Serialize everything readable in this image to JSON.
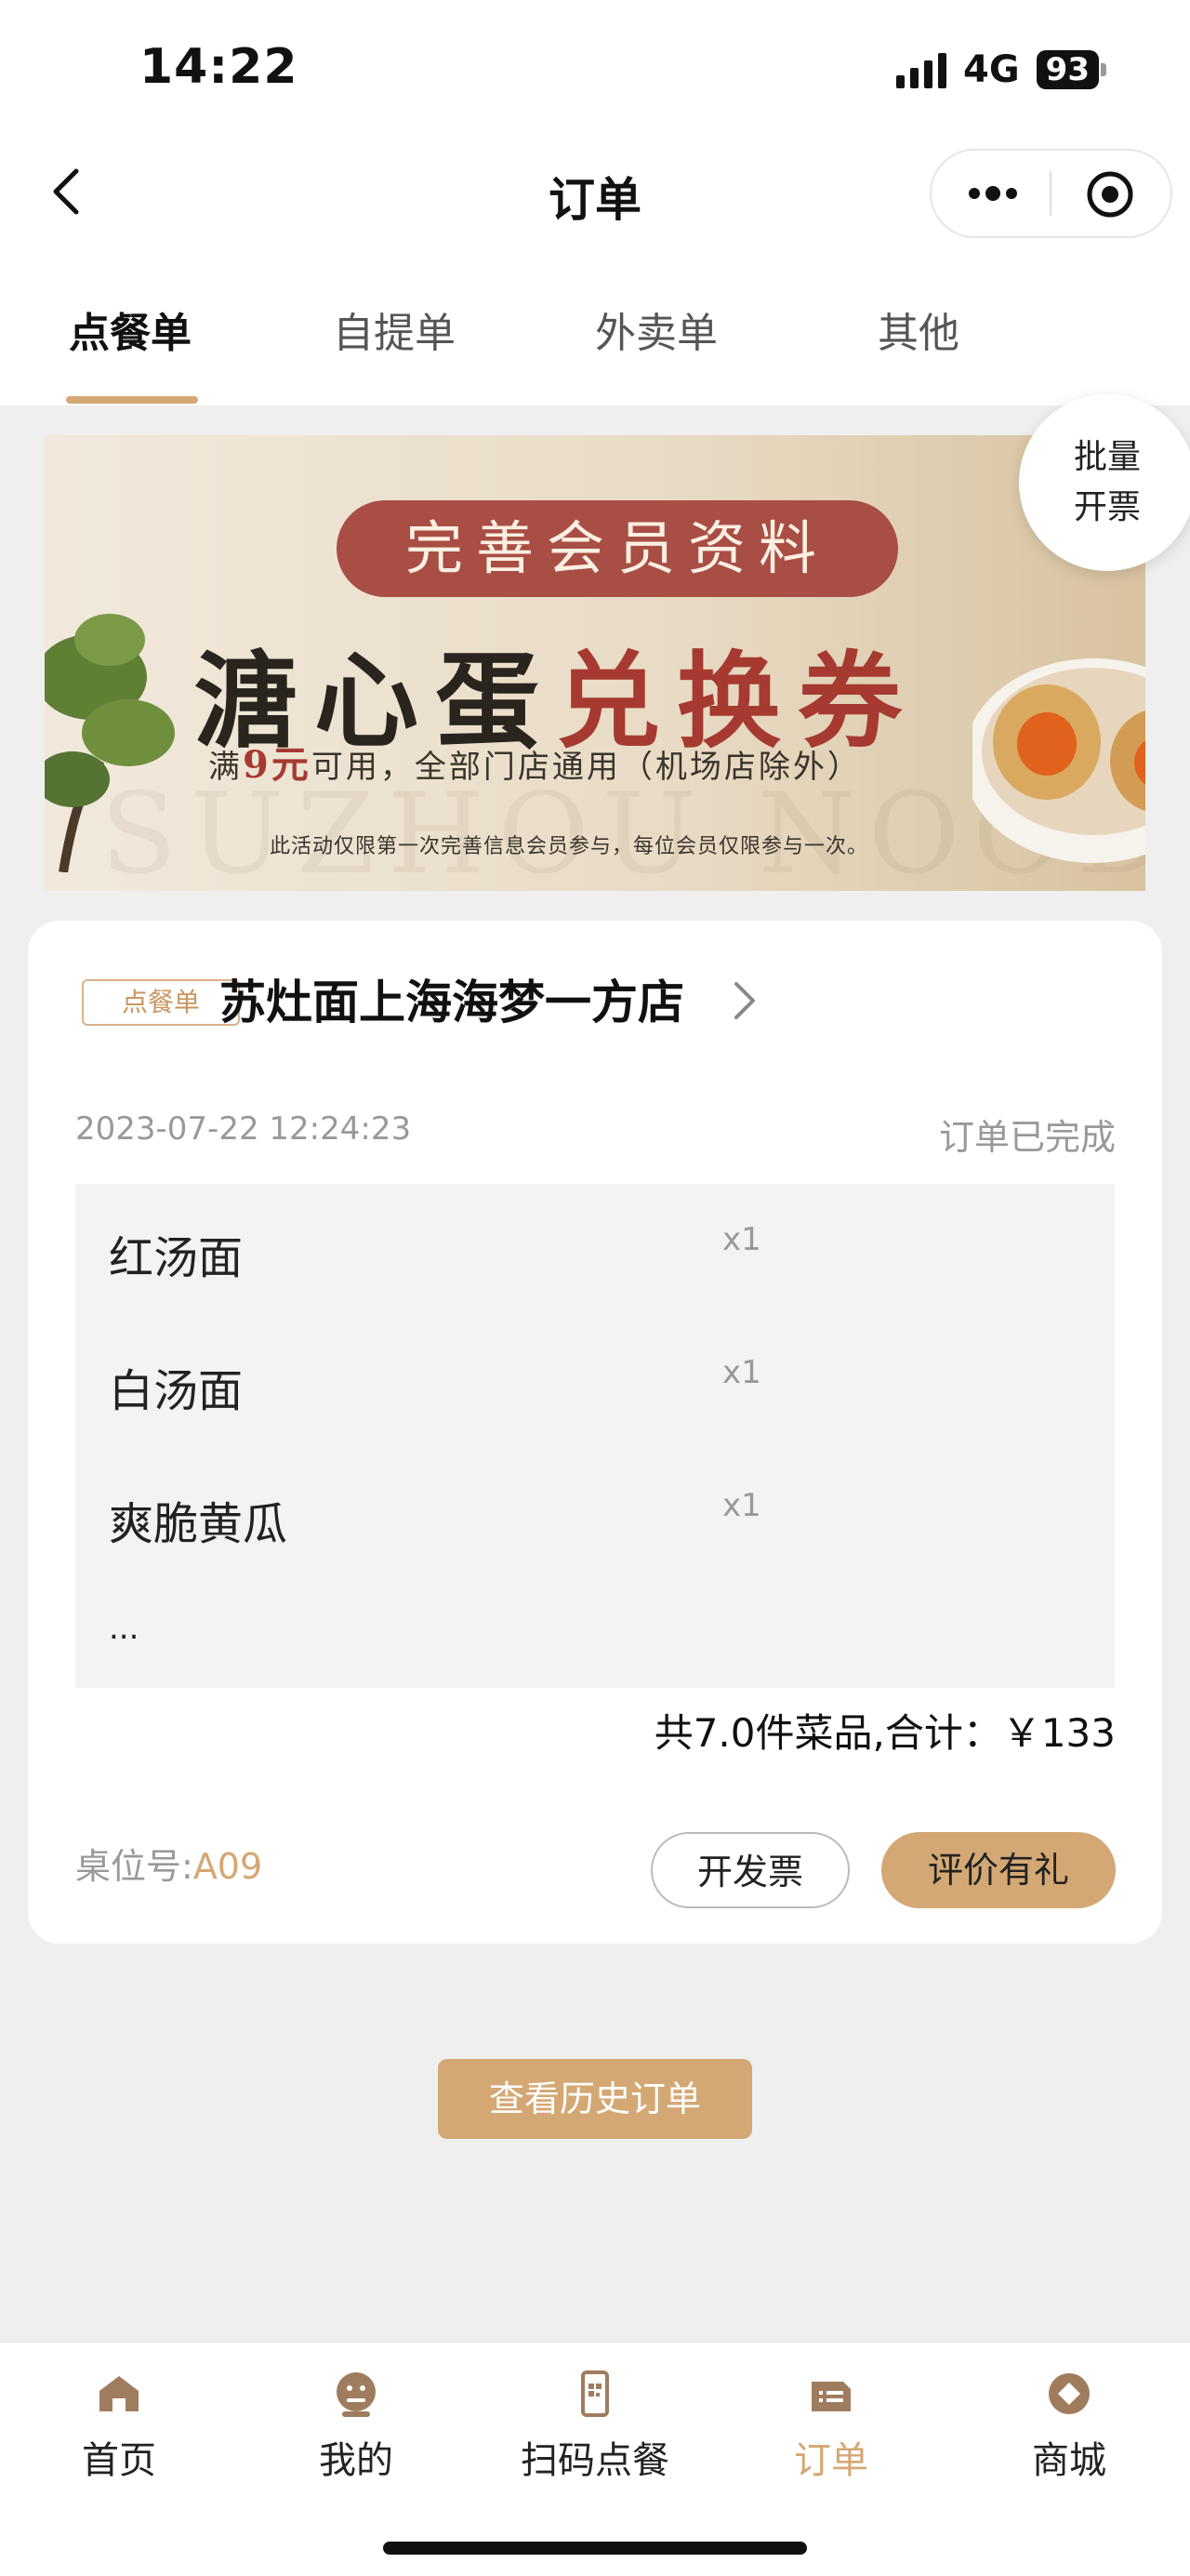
{
  "status_bar": {
    "time": "14:22",
    "network": "4G",
    "battery": "93"
  },
  "nav": {
    "title": "订单"
  },
  "tabs": [
    {
      "label": "点餐单",
      "active": true
    },
    {
      "label": "自提单",
      "active": false
    },
    {
      "label": "外卖单",
      "active": false
    },
    {
      "label": "其他",
      "active": false
    }
  ],
  "banner": {
    "pill": "完善会员资料",
    "headline_a": "溏心蛋",
    "headline_b": "兑换券",
    "line_pre": "满",
    "line_amount": "9元",
    "line_post": "可用，全部门店通用（机场店除外）",
    "note": "此活动仅限第一次完善信息会员参与，每位会员仅限参与一次。",
    "watermark": "SUZHOU NOODLE"
  },
  "batch_invoice": {
    "line1": "批量",
    "line2": "开票"
  },
  "order": {
    "type_badge": "点餐单",
    "store": "苏灶面上海海梦一方店",
    "time": "2023-07-22 12:24:23",
    "status": "订单已完成",
    "items": [
      {
        "name": "红汤面",
        "qty": "x1"
      },
      {
        "name": "白汤面",
        "qty": "x1"
      },
      {
        "name": "爽脆黄瓜",
        "qty": "x1"
      }
    ],
    "more": "...",
    "total": "共7.0件菜品,合计：￥133",
    "table_label": "桌位号:",
    "table_value": "A09",
    "invoice_label": "开发票",
    "review_label": "评价有礼"
  },
  "history_label": "查看历史订单",
  "tabbar": [
    {
      "label": "首页",
      "icon": "home-icon"
    },
    {
      "label": "我的",
      "icon": "profile-icon"
    },
    {
      "label": "扫码点餐",
      "icon": "scan-order-icon"
    },
    {
      "label": "订单",
      "icon": "orders-icon",
      "active": true
    },
    {
      "label": "商城",
      "icon": "mall-icon"
    }
  ],
  "colors": {
    "accent": "#d4a874",
    "banner_red": "#a94e45",
    "page_bg": "#efefef"
  }
}
